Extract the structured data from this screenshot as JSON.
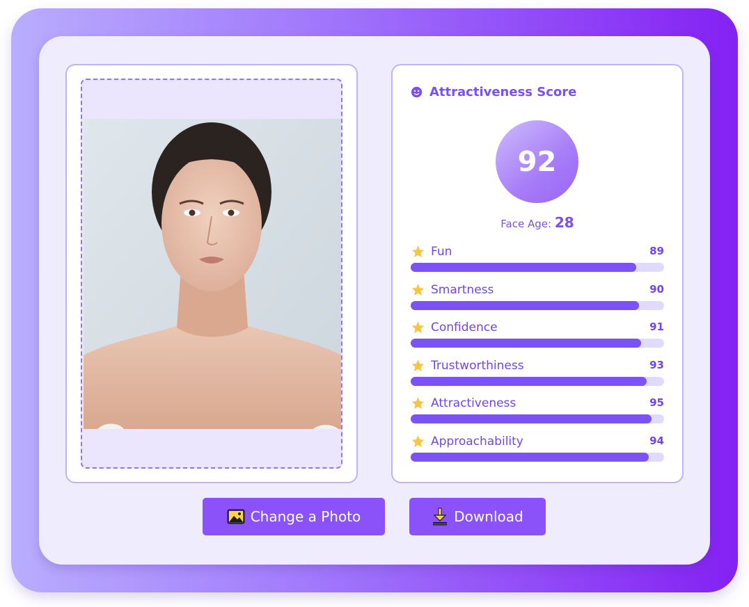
{
  "score_panel": {
    "title": "Attractiveness Score",
    "title_icon": "smiley-icon",
    "score": "92",
    "face_age_label": "Face Age:",
    "face_age_value": "28",
    "metrics": [
      {
        "label": "Fun",
        "value": 89,
        "value_text": "89",
        "icon": "star-icon"
      },
      {
        "label": "Smartness",
        "value": 90,
        "value_text": "90",
        "icon": "star-icon"
      },
      {
        "label": "Confidence",
        "value": 91,
        "value_text": "91",
        "icon": "star-icon"
      },
      {
        "label": "Trustworthiness",
        "value": 93,
        "value_text": "93",
        "icon": "star-icon"
      },
      {
        "label": "Attractiveness",
        "value": 95,
        "value_text": "95",
        "icon": "star-icon"
      },
      {
        "label": "Approachability",
        "value": 94,
        "value_text": "94",
        "icon": "star-icon"
      }
    ]
  },
  "actions": {
    "change_photo_label": "Change a Photo",
    "change_photo_icon": "image-icon",
    "download_label": "Download",
    "download_icon": "download-icon"
  },
  "colors": {
    "accent": "#7b52f3",
    "button": "#8b52f9",
    "track": "#e0dafd",
    "star": "#f6c544"
  }
}
